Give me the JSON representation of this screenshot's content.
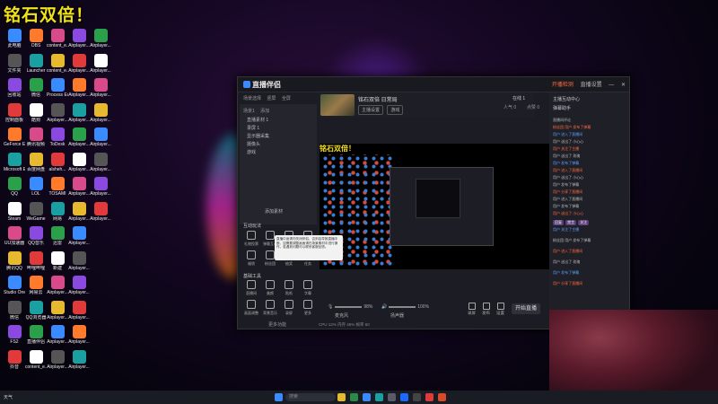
{
  "desktop": {
    "banner": "铭石双倍！",
    "icon_labels": [
      "此电脑",
      "文件夹",
      "回收站",
      "控制面板",
      "GeForce Experience",
      "Microsoft Edge",
      "QQ",
      "Steam",
      "UU加速器",
      "腾讯QQ",
      "Studio One",
      "微信",
      "FS2",
      "抖音",
      "OBS",
      "Launcher",
      "微信",
      "酷狗",
      "腾讯视频",
      "百度网盘",
      "LOL",
      "WeGame",
      "QQ音乐",
      "哔哩哔哩",
      "网易云",
      "QQ浏览器",
      "直播伴侣",
      "content_e...",
      "content_e...",
      "content_e...",
      "Process Explorer",
      "Airplayer...",
      "ToDesk",
      "alsheh...",
      "TOSAMI",
      "网易",
      "迅雷",
      "新建",
      "Airplayer...",
      "Airplayer...",
      "Airplayer...",
      "Airplayer...",
      "Airplayer...",
      "Airplayer...",
      "Airplayer...",
      "Airplayer...",
      "Airplayer...",
      "Airplayer...",
      "Airplayer...",
      "Airplayer...",
      "Airplayer...",
      "Airplayer...",
      "Airplayer...",
      "Airplayer...",
      "Airplayer...",
      "Airplayer...",
      "Airplayer...",
      "Airplayer...",
      "Airplayer...",
      "Airplayer...",
      "Airplayer...",
      "Airplayer...",
      "Airplayer...",
      "Airplayer..."
    ]
  },
  "app": {
    "title": "直播伴侣",
    "top_right": [
      "开播检测",
      "直播设置"
    ],
    "left": {
      "tabs": [
        "场景选择",
        "竖屏",
        "全屏"
      ],
      "scene_tabs": [
        "场景1",
        "添加"
      ],
      "scenes": [
        "直播素材 1",
        "录屏 1",
        "显示器采集",
        "摄像头",
        "游戏"
      ],
      "add_scene": "添加素材",
      "section_interact": "互动玩法",
      "interact_tools": [
        "礼物投票",
        "弹幕互动",
        "连线",
        "PK",
        "福袋",
        "粉丝团",
        "抽奖",
        "任务"
      ],
      "section_tools": "基础工具",
      "basic_tools": [
        "直播间",
        "美颜",
        "贴纸",
        "字幕",
        "画面调整",
        "背景音乐",
        "录屏",
        "更多"
      ],
      "more": "更多功能"
    },
    "center": {
      "stream_title": "铭石双倍 日常局",
      "tags": [
        "主播设置",
        "游戏"
      ],
      "stats": [
        "人气 0",
        "在线 1",
        "点赞 0"
      ],
      "mini_banner": "铭石双倍！",
      "tooltip": "直播中途请勿关闭伴侣，否则会导致直播中断。如需要调整画面请在场景素材中进行操作，若遇到问题可以联系客服反馈。",
      "vol_left": "98%",
      "vol_right": "100%",
      "vol_left_label": "麦克风",
      "vol_right_label": "扬声器",
      "controls": [
        "录屏",
        "发布",
        "设置"
      ],
      "start_button": "开始直播",
      "status": "CPU 12%  内存 45%  帧率 60"
    },
    "chat": {
      "header": "主播互动中心",
      "header2": "弹幕助手",
      "messages": [
        "直播间评论",
        "粉丝团 用户 发布了弹幕",
        "用户 进入了直播间",
        "用户 送出了 小心心",
        "用户 关注了主播",
        "用户 送出了 玫瑰",
        "用户 发布了弹幕",
        "用户 进入了直播间",
        "用户 送出了 小心心",
        "用户 发布了弹幕",
        "用户 分享了直播间",
        "用户 进入了直播间",
        "用户 发布了弹幕",
        "用户 送出了 小心心",
        "用户 关注了主播",
        "粉丝团 用户 发布了弹幕",
        "用户 进入了直播间",
        "用户 送出了 玫瑰",
        "用户 发布了弹幕",
        "用户 分享了直播间"
      ],
      "chat_buttons": [
        "回复",
        "禁言",
        "关注"
      ]
    }
  },
  "taskbar": {
    "weather": "天气",
    "search_placeholder": "搜索"
  },
  "colors": {
    "accent": "#ff6a3d",
    "banner": "#f3e21a"
  }
}
